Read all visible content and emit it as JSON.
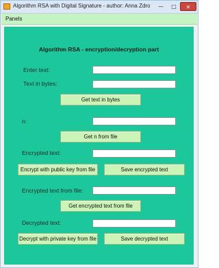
{
  "window": {
    "title": "Algorithm RSA with Digital Signature - author: Anna Zdrojews...",
    "minimize_glyph": "—",
    "maximize_glyph": "□",
    "close_glyph": "✕"
  },
  "menu": {
    "panels": "Panels"
  },
  "panel": {
    "heading": "Algorithm RSA - encryption/decryption part",
    "enter_text_label": "Enter text:",
    "enter_text_value": "",
    "text_in_bytes_label": "Text in bytes:",
    "text_in_bytes_value": "",
    "get_text_in_bytes_button": "Get text in bytes",
    "n_label": "n:",
    "n_value": "",
    "get_n_button": "Get n from file",
    "encrypted_text_label": "Encrypted text:",
    "encrypted_text_value": "",
    "encrypt_button": "Encrypt with public key from file",
    "save_encrypted_button": "Save encrypted text",
    "encrypted_from_file_label": "Encrypted text from file:",
    "encrypted_from_file_value": "",
    "get_encrypted_button": "Get encrypted text from file",
    "decrypted_text_label": "Decrypted text:",
    "decrypted_text_value": "",
    "decrypt_button": "Decrypt with private key from file",
    "save_decrypted_button": "Save decrypted text"
  },
  "colors": {
    "panel_bg": "#1cc89b",
    "button_bg": "#ccf3b8",
    "menubar_bg": "#c6f3c4",
    "close_button": "#c9473f"
  },
  "icons": {
    "app": "java-app-icon"
  }
}
